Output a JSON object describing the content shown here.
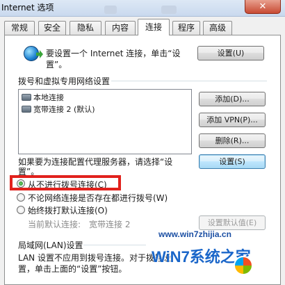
{
  "window": {
    "title": "Internet 选项",
    "close_glyph": "✕"
  },
  "tabs": [
    {
      "label": "常规"
    },
    {
      "label": "安全"
    },
    {
      "label": "隐私"
    },
    {
      "label": "内容"
    },
    {
      "label": "连接"
    },
    {
      "label": "程序"
    },
    {
      "label": "高级"
    }
  ],
  "active_tab": "连接",
  "setup": {
    "line1": "要设置一个 Internet 连接，单击“设",
    "line2": "置”。",
    "button": "设置(U)"
  },
  "dialup": {
    "heading": "拨号和虚拟专用网络设置",
    "connections": [
      "本地连接",
      "宽带连接 2 (默认)"
    ],
    "add_button": "添加(D)...",
    "add_vpn_button": "添加 VPN(P)...",
    "delete_button": "删除(R)...",
    "proxy_line1": "如果要为连接配置代理服务器，请选择“设",
    "proxy_line2": "置”。",
    "settings_button": "设置(S)"
  },
  "dial_options": {
    "never": "从不进行拨号连接(C)",
    "when_no_network": "不论网络连接是否存在都进行拨号(W)",
    "always": "始终拨打默认连接(O)",
    "selected": "never"
  },
  "default_conn": {
    "label": "当前默认连接:",
    "value": "宽带连接 2",
    "set_default_button": "设置默认值(E)"
  },
  "lan": {
    "heading": "局域网(LAN)设置",
    "line1": "LAN 设置不应用到拨号连接。对于拨号设",
    "line2": "置，单击上面的“设置”按钮。"
  },
  "watermark": {
    "text": "WiN7系统之家",
    "url": "www.win7zhijia.cn"
  },
  "colors": {
    "highlight": "#e1211c",
    "tab_border": "#8e8f8f"
  }
}
